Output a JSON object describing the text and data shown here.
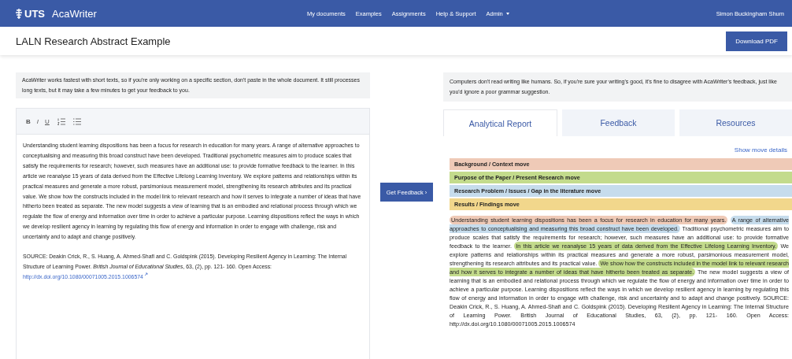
{
  "navbar": {
    "logo": "UTS",
    "app_name": "AcaWriter",
    "links": [
      {
        "label": "My documents",
        "dropdown": false
      },
      {
        "label": "Examples",
        "dropdown": false
      },
      {
        "label": "Assignments",
        "dropdown": false
      },
      {
        "label": "Help & Support",
        "dropdown": false
      },
      {
        "label": "Admin",
        "dropdown": true
      }
    ],
    "user": "Simon Buckingham Shum"
  },
  "page": {
    "title": "LALN Research Abstract Example",
    "download_button": "Download PDF"
  },
  "editor": {
    "notice": "AcaWriter works fastest with short texts, so if you're only working on a specific section, don't paste in the whole document. It still processes long texts, but it may take a few minutes to get your feedback to you.",
    "toolbar": [
      "B",
      "I",
      "U"
    ],
    "paragraphs": [
      "Understanding student learning dispositions has been a focus for research in education for many years. A range of alternative approaches to conceptualising and measuring this broad construct have been developed. Traditional psychometric measures aim to produce scales that satisfy the requirements for research; however, such measures have an additional use: to provide formative feedback to the learner. In this article we reanalyse 15 years of data derived from the Effective Lifelong Learning Inventory. We explore patterns and relationships within its practical measures and generate a more robust, parsimonious measurement model, strengthening its research attributes and its practical value. We show how the constructs included in the model link to relevant research and how it serves to integrate a number of ideas that have hitherto been treated as separate. The new model suggests a view of learning that is an embodied and relational process through which we regulate the flow of energy and information over time in order to achieve a particular purpose. Learning dispositions reflect the ways in which we develop resilient agency in learning by regulating this flow of energy and information in order to engage with challenge, risk and uncertainty and to adapt and change positively.",
      "SOURCE: Deakin Crick, R., S. Huang, A. Ahmed-Shafi and C. Goldspink (2015). Developing Resilient Agency in Learning: The Internal Structure of Learning Power. *British Journal of Educational Studies*, 63, (2), pp. 121- 160. Open Access: "
    ],
    "link": "http://dx.doi.org/10.1080/00071005.2015.1006574"
  },
  "get_feedback_button": "Get Feedback ›",
  "report": {
    "notice": "Computers don't read writing like humans. So, if you're sure your writing's good, it's fine to disagree with AcaWriter's feedback, just like you'd ignore a poor grammar suggestion.",
    "tabs": [
      {
        "label": "Analytical Report",
        "selected": true
      },
      {
        "label": "Feedback",
        "selected": false
      },
      {
        "label": "Resources",
        "selected": false
      }
    ],
    "show_details_link": "Show move details",
    "moves": [
      {
        "label": "Background / Context move",
        "color": "#efcab7"
      },
      {
        "label": "Purpose of the Paper / Present Research move",
        "color": "#c3db8c"
      },
      {
        "label": "Research Problem / Issues / Gap in the literature move",
        "color": "#c6dcec"
      },
      {
        "label": "Results / Findings move",
        "color": "#f2d78c"
      }
    ],
    "segments": [
      {
        "text": "Understanding student learning dispositions has been a focus for research in education for many years.",
        "color": "#efcab7"
      },
      {
        "text": "A range of alternative approaches to conceptualising and measuring this broad construct have been developed.",
        "color": "#c6dcec"
      },
      {
        "text": "Traditional psychometric measures aim to produce scales that satisfy the requirements for research; however, such measures have an additional use: to provide formative feedback to the learner."
      },
      {
        "text": "In this article we reanalyse 15 years of data derived from the Effective Lifelong Learning Inventory.",
        "color": "#c3db8c"
      },
      {
        "text": "We explore patterns and relationships within its practical measures and generate a more robust, parsimonious measurement model, strengthening its research attributes and its practical value."
      },
      {
        "text": "We show how the constructs included in the model link to relevant research and how it serves to integrate a number of ideas that have hitherto been treated as separate.",
        "color": "#c3db8c"
      },
      {
        "text": "The new model suggests a view of learning that is an embodied and relational process through which we regulate the flow of energy and information over time in order to achieve a particular purpose. Learning dispositions reflect the ways in which we develop resilient agency in learning by regulating this flow of energy and information in order to engage with challenge, risk and uncertainty and to adapt and change positively."
      },
      {
        "text": "SOURCE: Deakin Crick, R., S. Huang, A. Ahmed-Shafi and C. Goldspink (2015). Developing Resilient Agency in Learning: The Internal Structure of Learning Power. British Journal of Educational Studies, 63, (2), pp. 121- 160. Open Access: http://dx.doi.org/10.1080/00071005.2015.1006574"
      }
    ]
  }
}
